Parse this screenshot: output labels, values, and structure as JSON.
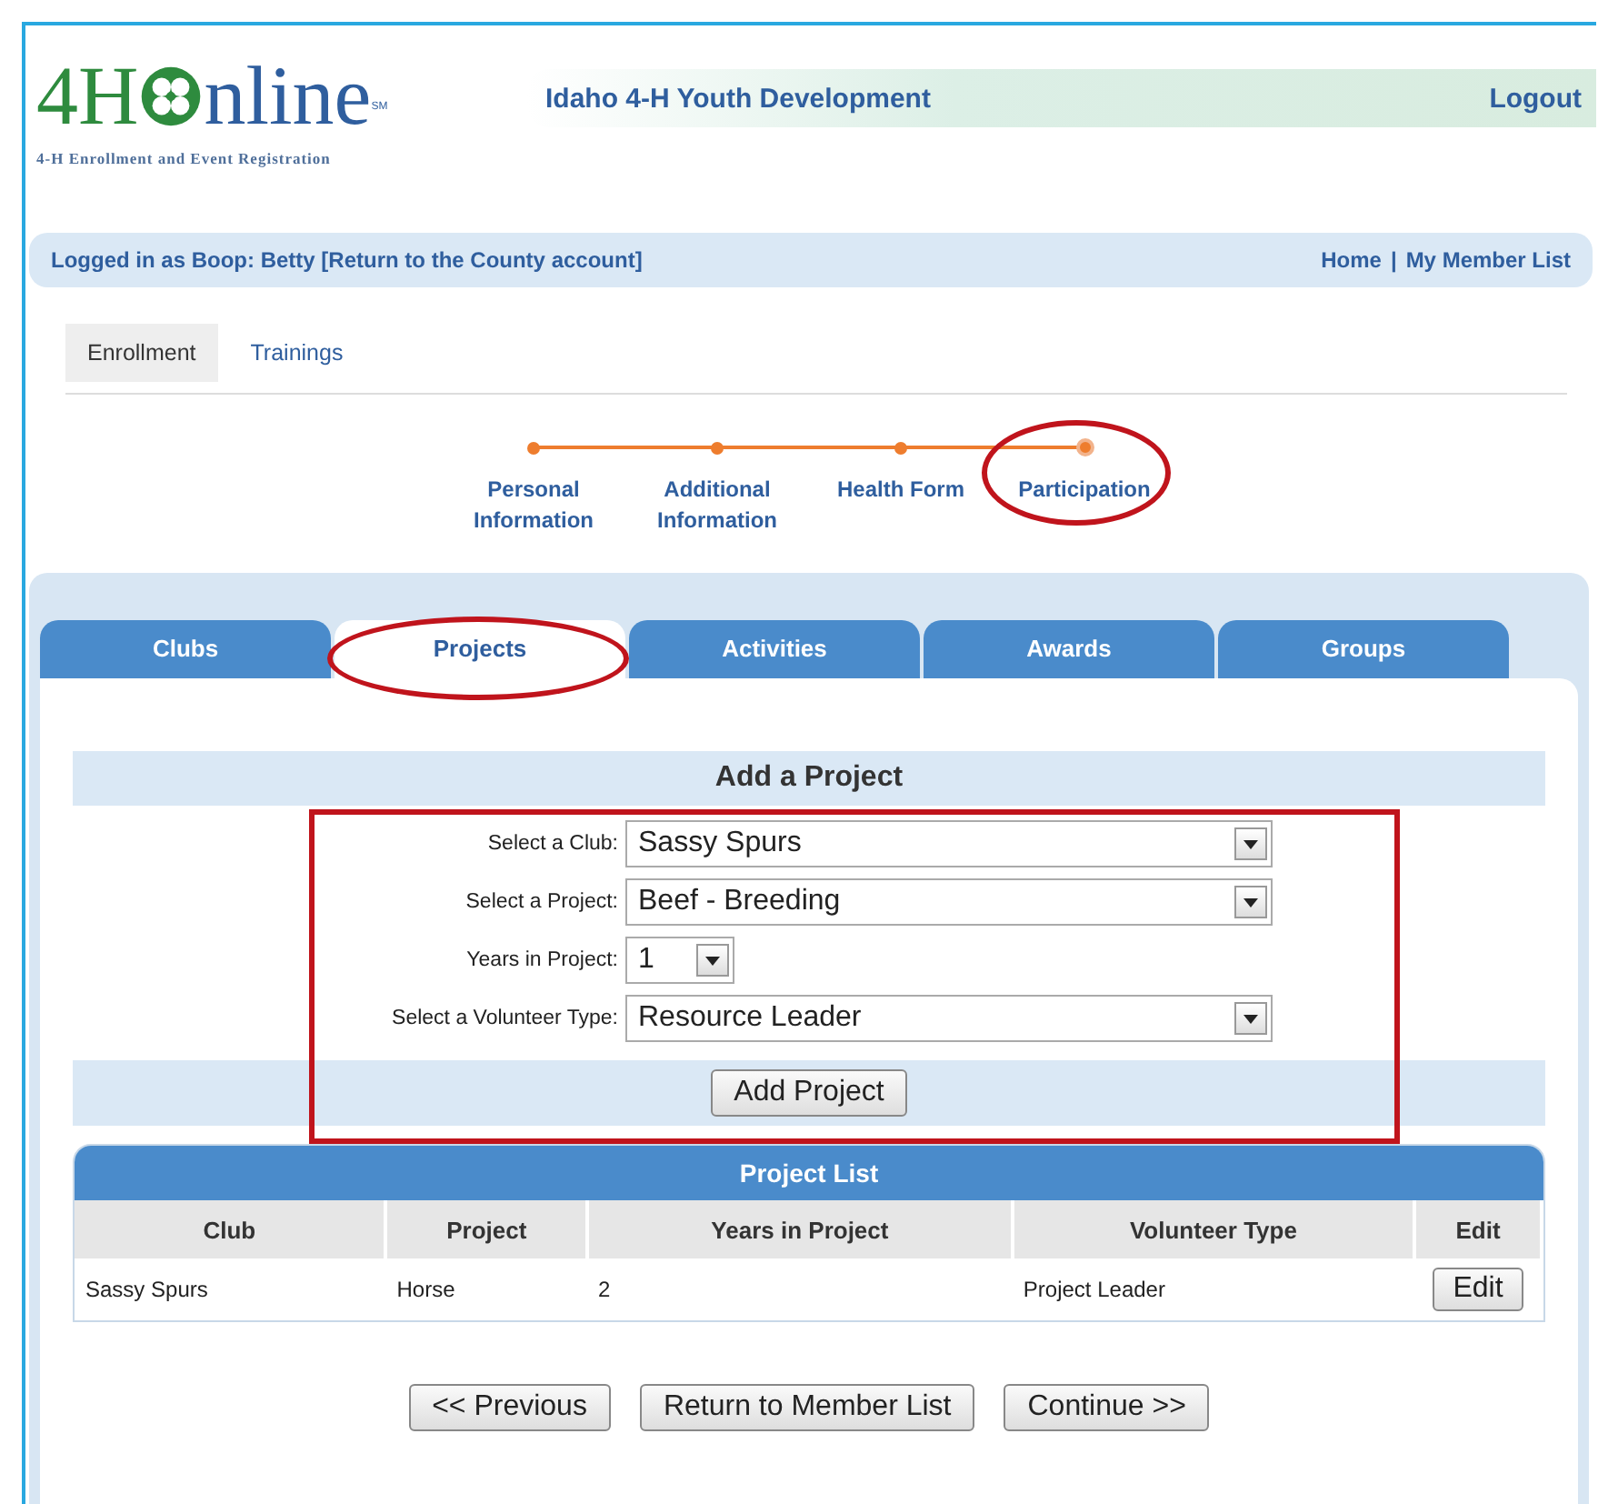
{
  "logo": {
    "lead": "4H",
    "rest": "nline",
    "mark": "SM",
    "tagline": "4-H Enrollment and Event Registration"
  },
  "header": {
    "title": "Idaho 4-H Youth Development",
    "logout": "Logout"
  },
  "login_bar": {
    "text": "Logged in as Boop: Betty [Return to the County account]",
    "links": [
      "Home",
      "My Member List"
    ],
    "separator": "|"
  },
  "top_tabs": [
    {
      "label": "Enrollment",
      "selected": true
    },
    {
      "label": "Trainings",
      "selected": false
    }
  ],
  "steps": [
    {
      "label": "Personal Information",
      "selected": false,
      "highlighted": false
    },
    {
      "label": "Additional Information",
      "selected": false,
      "highlighted": false
    },
    {
      "label": "Health Form",
      "selected": false,
      "highlighted": false
    },
    {
      "label": "Participation",
      "selected": true,
      "highlighted": true
    }
  ],
  "tabs": [
    {
      "label": "Clubs",
      "selected": false,
      "highlighted": false
    },
    {
      "label": "Projects",
      "selected": true,
      "highlighted": true
    },
    {
      "label": "Activities",
      "selected": false,
      "highlighted": false
    },
    {
      "label": "Awards",
      "selected": false,
      "highlighted": false
    },
    {
      "label": "Groups",
      "selected": false,
      "highlighted": false
    }
  ],
  "add_project": {
    "title": "Add a Project",
    "highlighted": true,
    "fields": [
      {
        "label": "Select a Club:",
        "value": "Sassy Spurs",
        "kind": "wide"
      },
      {
        "label": "Select a Project:",
        "value": "Beef - Breeding",
        "kind": "wide"
      },
      {
        "label": "Years in Project:",
        "value": "1",
        "kind": "narrow"
      },
      {
        "label": "Select a Volunteer Type:",
        "value": "Resource Leader",
        "kind": "wide"
      }
    ],
    "button": "Add Project"
  },
  "project_list": {
    "title": "Project List",
    "columns": [
      "Club",
      "Project",
      "Years in Project",
      "Volunteer Type",
      "Edit"
    ],
    "rows": [
      {
        "cells": [
          "Sassy Spurs",
          "Horse",
          "2",
          "Project Leader"
        ],
        "action": "Edit"
      }
    ]
  },
  "buttons": [
    "<< Previous",
    "Return to Member List",
    "Continue >>"
  ]
}
